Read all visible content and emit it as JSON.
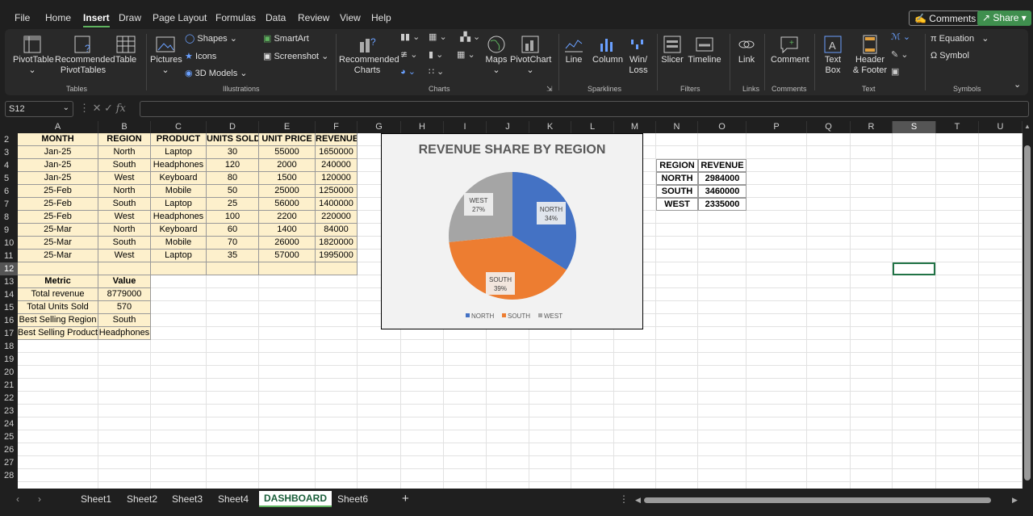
{
  "menu": {
    "tabs": [
      "File",
      "Home",
      "Insert",
      "Draw",
      "Page Layout",
      "Formulas",
      "Data",
      "Review",
      "View",
      "Help"
    ],
    "comments_label": "Comments",
    "share_label": "Share"
  },
  "ribbon": {
    "pivot_table": "PivotTable",
    "rec_pivot_1": "Recommended",
    "rec_pivot_2": "PivotTables",
    "table": "Table",
    "group_tables": "Tables",
    "pictures": "Pictures",
    "shapes": "Shapes",
    "icons": "Icons",
    "models3d": "3D Models",
    "smartart": "SmartArt",
    "screenshot": "Screenshot",
    "group_illustrations": "Illustrations",
    "rec_charts_1": "Recommended",
    "rec_charts_2": "Charts",
    "maps": "Maps",
    "pivot_chart": "PivotChart",
    "group_charts": "Charts",
    "line": "Line",
    "column": "Column",
    "winloss_1": "Win/",
    "winloss_2": "Loss",
    "group_sparklines": "Sparklines",
    "slicer": "Slicer",
    "timeline": "Timeline",
    "group_filters": "Filters",
    "link": "Link",
    "group_links": "Links",
    "comment": "Comment",
    "group_comments": "Comments",
    "textbox_1": "Text",
    "textbox_2": "Box",
    "header_1": "Header",
    "header_2": "& Footer",
    "group_text": "Text",
    "equation": "Equation",
    "symbol": "Symbol",
    "group_symbols": "Symbols"
  },
  "formula_bar": {
    "name_box": "S12",
    "fx": "fx",
    "formula": ""
  },
  "columns": [
    "A",
    "B",
    "C",
    "D",
    "E",
    "F",
    "G",
    "H",
    "I",
    "J",
    "K",
    "L",
    "M",
    "N",
    "O",
    "P",
    "Q",
    "R",
    "S",
    "T",
    "U"
  ],
  "rows": [
    "2",
    "3",
    "4",
    "5",
    "6",
    "7",
    "8",
    "9",
    "10",
    "11",
    "12",
    "13",
    "14",
    "15",
    "16",
    "17",
    "18",
    "19",
    "20",
    "21",
    "22",
    "23",
    "24",
    "25",
    "26",
    "27",
    "28"
  ],
  "data_table": {
    "headers": [
      "MONTH",
      "REGION",
      "PRODUCT",
      "UNITS SOLD",
      "UNIT PRICE",
      "REVENUE"
    ],
    "rows": [
      [
        "Jan-25",
        "North",
        "Laptop",
        "30",
        "55000",
        "1650000"
      ],
      [
        "Jan-25",
        "South",
        "Headphones",
        "120",
        "2000",
        "240000"
      ],
      [
        "Jan-25",
        "West",
        "Keyboard",
        "80",
        "1500",
        "120000"
      ],
      [
        "25-Feb",
        "North",
        "Mobile",
        "50",
        "25000",
        "1250000"
      ],
      [
        "25-Feb",
        "South",
        "Laptop",
        "25",
        "56000",
        "1400000"
      ],
      [
        "25-Feb",
        "West",
        "Headphones",
        "100",
        "2200",
        "220000"
      ],
      [
        "25-Mar",
        "North",
        "Keyboard",
        "60",
        "1400",
        "84000"
      ],
      [
        "25-Mar",
        "South",
        "Mobile",
        "70",
        "26000",
        "1820000"
      ],
      [
        "25-Mar",
        "West",
        "Laptop",
        "35",
        "57000",
        "1995000"
      ]
    ]
  },
  "metrics": {
    "headers": [
      "Metric",
      "Value"
    ],
    "rows": [
      [
        "Total revenue",
        "8779000"
      ],
      [
        "Total Units Sold",
        "570"
      ],
      [
        "Best Selling Region",
        "South"
      ],
      [
        "Best Selling Product",
        "Headphones"
      ]
    ]
  },
  "summary": {
    "headers": [
      "REGION",
      "REVENUE"
    ],
    "rows": [
      [
        "NORTH",
        "2984000"
      ],
      [
        "SOUTH",
        "3460000"
      ],
      [
        "WEST",
        "2335000"
      ]
    ]
  },
  "chart_data": {
    "type": "pie",
    "title": "REVENUE SHARE BY REGION",
    "categories": [
      "NORTH",
      "SOUTH",
      "WEST"
    ],
    "values": [
      2984000,
      3460000,
      2335000
    ],
    "percent_labels": [
      "34%",
      "39%",
      "27%"
    ],
    "colors": [
      "#4472c4",
      "#ed7d31",
      "#a5a5a5"
    ],
    "legend": "bottom"
  },
  "sheet_tabs": [
    "Sheet1",
    "Sheet2",
    "Sheet3",
    "Sheet4",
    "DASHBOARD",
    "Sheet6"
  ],
  "active_tab": "DASHBOARD",
  "add_sheet": "+"
}
